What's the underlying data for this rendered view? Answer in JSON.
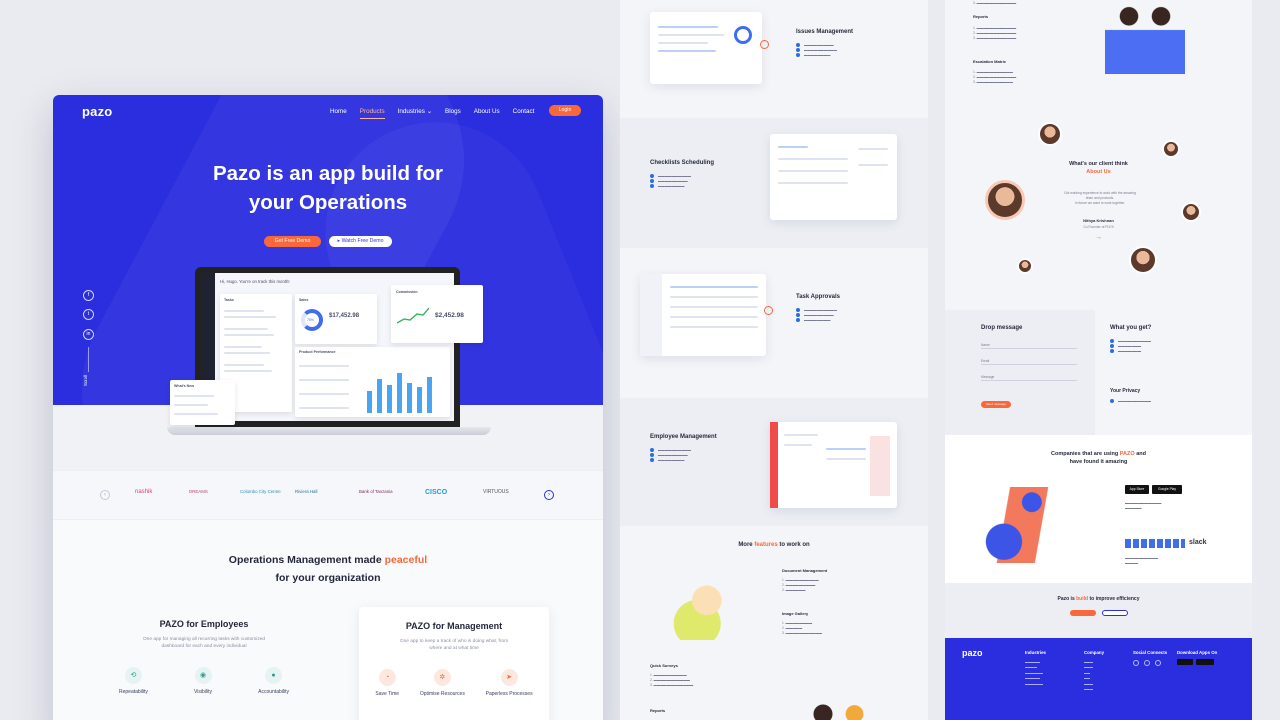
{
  "main": {
    "logo": "pazo",
    "nav": [
      "Home",
      "Products",
      "Industries",
      "Blogs",
      "About Us",
      "Contact"
    ],
    "login": "Login",
    "hero_title_1": "Pazo is an app build for",
    "hero_title_2": "your Operations",
    "cta_demo": "Get Free Demo",
    "cta_watch": "Watch Free Demo",
    "scroll": "Scroll",
    "dash": {
      "greeting": "Hi, Hugo. You're on track this month!",
      "tasks": "Tasks",
      "sales": "Sales",
      "sales_value": "$17,452.98",
      "sales_pct": "75%",
      "commission": "Commission",
      "commission_value": "$2,452.98",
      "performance": "Product Performance",
      "whats_new": "What's New"
    },
    "partners": [
      "nashik",
      "DREAMS",
      "Colombo City Centre",
      "Riviera Hall",
      "Bank of Tanzania",
      "CISCO",
      "VIRTUOUS"
    ],
    "ops_title_1": "Operations Management made",
    "ops_title_accent": "peaceful",
    "ops_title_2": "for your organization",
    "employees": {
      "title": "PAZO for Employees",
      "desc_1": "One app for managing all recurring tasks with customized",
      "desc_2": "dashboard for each and every individual",
      "features": [
        "Repeatability",
        "Visibility",
        "Accountability"
      ]
    },
    "management": {
      "title": "PAZO for Management",
      "desc_1": "One app to keep a track of who is doing what, from",
      "desc_2": "where and at what time",
      "features": [
        "Save Time",
        "Optimise Resources",
        "Paperless Processes"
      ]
    }
  },
  "middle": {
    "issues": "Issues Management",
    "checklists": "Checklists Scheduling",
    "approvals": "Task Approvals",
    "employee": "Employee Management",
    "more_1": "More",
    "more_accent": "features",
    "more_2": "to work on",
    "doc": "Document Management",
    "gallery": "Image Gallery",
    "surveys": "Quick Surveys",
    "reports": "Reports"
  },
  "right": {
    "reports": "Reports",
    "escalation": "Escalation Matrix",
    "client_title": "What's our client think",
    "client_accent": "About Us",
    "testimonial_1": "Got working experience to work with the amazing",
    "testimonial_2": "team and products.",
    "testimonial_3": "In future we want to work together.",
    "client_name": "Nithya Krishnan",
    "client_role": "Co-Founder of PLEX",
    "drop": "Drop message",
    "fields": [
      "Name",
      "Email",
      "Message"
    ],
    "send": "Send message",
    "what_you_get": "What you get?",
    "privacy": "Your Privacy",
    "companies_1": "Companies that are using",
    "companies_accent": "PAZO",
    "companies_2": "and",
    "companies_3": "have found it amazing",
    "appstore": "App Store",
    "googleplay": "Google Play",
    "slack": "slack",
    "improve_1": "Pazo is",
    "improve_accent": "build",
    "improve_2": "to improve efficiency",
    "footer": {
      "logo": "pazo",
      "industries": "Industries",
      "company": "Company",
      "social": "Social Connects",
      "download": "Download Apps On"
    }
  }
}
